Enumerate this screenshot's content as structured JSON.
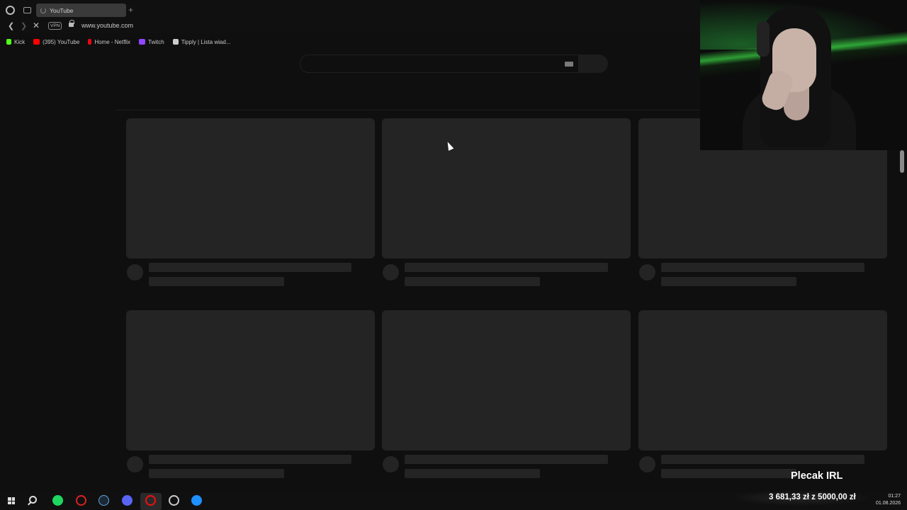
{
  "browser": {
    "tab_title": "YouTube",
    "new_tab": "+",
    "vpn": "VPN",
    "url": "www.youtube.com",
    "bookmarks": [
      {
        "label": "Kick",
        "color": "#53fc18"
      },
      {
        "label": "(395) YouTube",
        "color": "#ff0000"
      },
      {
        "label": "Home - Netflix",
        "color": "#e50914"
      },
      {
        "label": "Twitch",
        "color": "#9146ff"
      },
      {
        "label": "Tipply | Lista wiad...",
        "color": "#cccccc"
      }
    ]
  },
  "page": {
    "search_placeholder": "",
    "state": "loading skeleton"
  },
  "overlay": {
    "label": "Plecak IRL",
    "donation_progress": "3 681,33 zł z 5000,00 zł"
  },
  "taskbar": {
    "time": "01:27",
    "date": "01.08.2026",
    "icons": [
      "windows-icon",
      "search-icon",
      "spotify-icon",
      "opera-gx-icon",
      "steam-icon",
      "discord-icon",
      "opera-icon",
      "obs-icon",
      "steam-icon"
    ]
  }
}
